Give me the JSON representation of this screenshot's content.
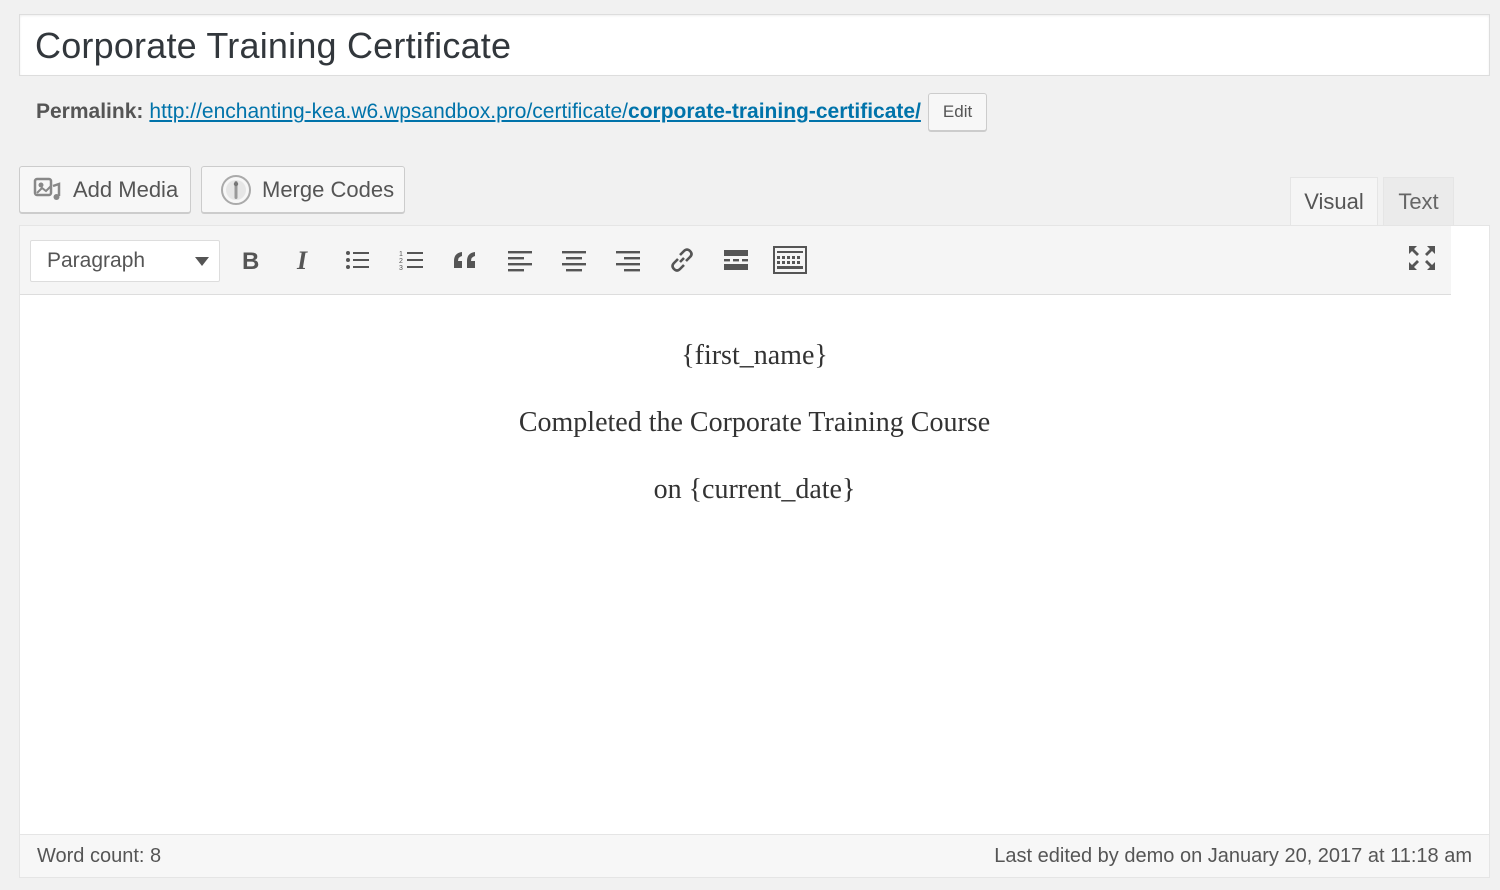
{
  "post": {
    "title": "Corporate Training Certificate"
  },
  "permalink": {
    "label": "Permalink:",
    "url_base": "http://enchanting-kea.w6.wpsandbox.pro/certificate/",
    "url_slug": "corporate-training-certificate/",
    "edit_label": "Edit"
  },
  "media_buttons": {
    "add_media": "Add Media",
    "merge_codes": "Merge Codes"
  },
  "editor_tabs": {
    "visual": "Visual",
    "text": "Text",
    "active": "Visual"
  },
  "toolbar": {
    "format_select": "Paragraph",
    "buttons": [
      "bold-icon",
      "italic-icon",
      "bullet-list-icon",
      "numbered-list-icon",
      "blockquote-icon",
      "align-left-icon",
      "align-center-icon",
      "align-right-icon",
      "link-icon",
      "read-more-icon",
      "toolbar-toggle-icon"
    ],
    "fullscreen": "fullscreen-icon"
  },
  "content": {
    "line1": "{first_name}",
    "line2": "Completed the Corporate Training Course",
    "line3": "on {current_date}"
  },
  "status": {
    "word_count": "Word count: 8",
    "last_edited": "Last edited by demo on January 20, 2017 at 11:18 am"
  },
  "colors": {
    "link": "#0073aa",
    "background": "#f1f1f1"
  }
}
